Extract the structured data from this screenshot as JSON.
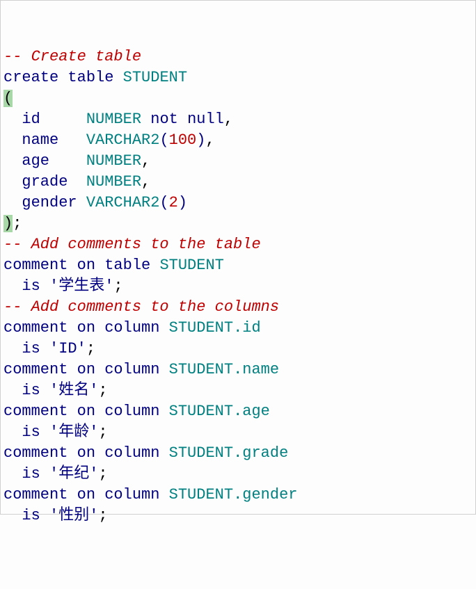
{
  "lines": {
    "l1_comment": "-- Create table",
    "l2_create": "create",
    "l2_table": "table",
    "l2_student": "STUDENT",
    "l3_lparen": "(",
    "l4_id": "id",
    "l4_type": "NUMBER",
    "l4_not": "not",
    "l4_null": "null",
    "l5_name": "name",
    "l5_type": "VARCHAR2",
    "l5_num": "100",
    "l6_age": "age",
    "l6_type": "NUMBER",
    "l7_grade": "grade",
    "l7_type": "NUMBER",
    "l8_gender": "gender",
    "l8_type": "VARCHAR2",
    "l8_num": "2",
    "l9_rparen": ")",
    "l10_comment": "-- Add comments to the table",
    "l11_comment": "comment",
    "l11_on": "on",
    "l11_table": "table",
    "l11_student": "STUDENT",
    "l12_is": "is",
    "l12_str": "'学生表'",
    "l13_comment": "-- Add comments to the columns",
    "l14_comment": "comment",
    "l14_on": "on",
    "l14_column": "column",
    "l14_target": "STUDENT.id",
    "l15_is": "is",
    "l15_str": "'ID'",
    "l16_comment": "comment",
    "l16_on": "on",
    "l16_column": "column",
    "l16_target": "STUDENT.name",
    "l17_is": "is",
    "l17_str": "'姓名'",
    "l18_comment": "comment",
    "l18_on": "on",
    "l18_column": "column",
    "l18_target": "STUDENT.age",
    "l19_is": "is",
    "l19_str": "'年龄'",
    "l20_comment": "comment",
    "l20_on": "on",
    "l20_column": "column",
    "l20_target": "STUDENT.grade",
    "l21_is": "is",
    "l21_str": "'年纪'",
    "l22_comment": "comment",
    "l22_on": "on",
    "l22_column": "column",
    "l22_target": "STUDENT.gender",
    "l23_is": "is",
    "l23_str": "'性别'"
  }
}
